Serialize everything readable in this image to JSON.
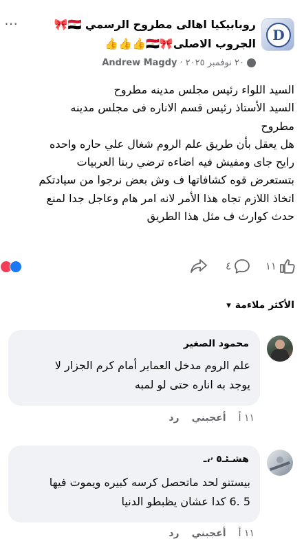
{
  "header": {
    "group_name": "روبابيكيا اهالى مطروح الرسمي 🇪🇬🎀 الجروب الاصلى🎀🇪🇬👍👍👍",
    "author": "Andrew Magdy",
    "date": "٢٠ نوفمبر ٢٠٢٥",
    "separator": "·",
    "more_icon": "⋯"
  },
  "post": {
    "text": "السيد اللواء رئيس مجلس مدينه مطروح\nالسيد الأستاذ رئيس قسم الاناره فى مجلس مدينه\nمطروح\nهل يعقل بأن طريق علم الروم شغال علي حاره واحده\nرايح جاى ومفيش فيه اضاءه ترضي ربنا العربيات\nبتستعرض قوه كشافاتها ف وش بعض نرجوا من سيادتكم\nاتخاذ اللازم تجاه هذا الأمر لانه امر هام وعاجل جدا لمنع\nحدث كوارث ف مثل هذا الطريق"
  },
  "actions": {
    "like_count": "١١",
    "comment_count": "٤",
    "reaction_colors": [
      "#f33e58",
      "#1877f2"
    ]
  },
  "sort": {
    "label": "الأكثر ملاءمة",
    "chevron": "▾"
  },
  "comments": [
    {
      "author": "محمود الصغير",
      "text": "علم الروم مدخل العماير أمام كرم الجزار لا\nيوجد به اناره حتى لو لمبه",
      "time": "١١ أ",
      "like_label": "أعجبني",
      "reply_label": "رد"
    },
    {
      "author": "هشـئـ٥ ۥ،ـ",
      "text": "بيستنو لحد ماتحصل كرسه كبيره ويموت فيها\n5 .6 كدا عشان يظبطو الدنيا",
      "time": "١١ أ",
      "like_label": "أعجبني",
      "reply_label": "رد"
    }
  ],
  "colors": {
    "text": "#050505",
    "secondary": "#65676b",
    "bubble": "#f0f2f5",
    "link_blue": "#1877f2"
  }
}
